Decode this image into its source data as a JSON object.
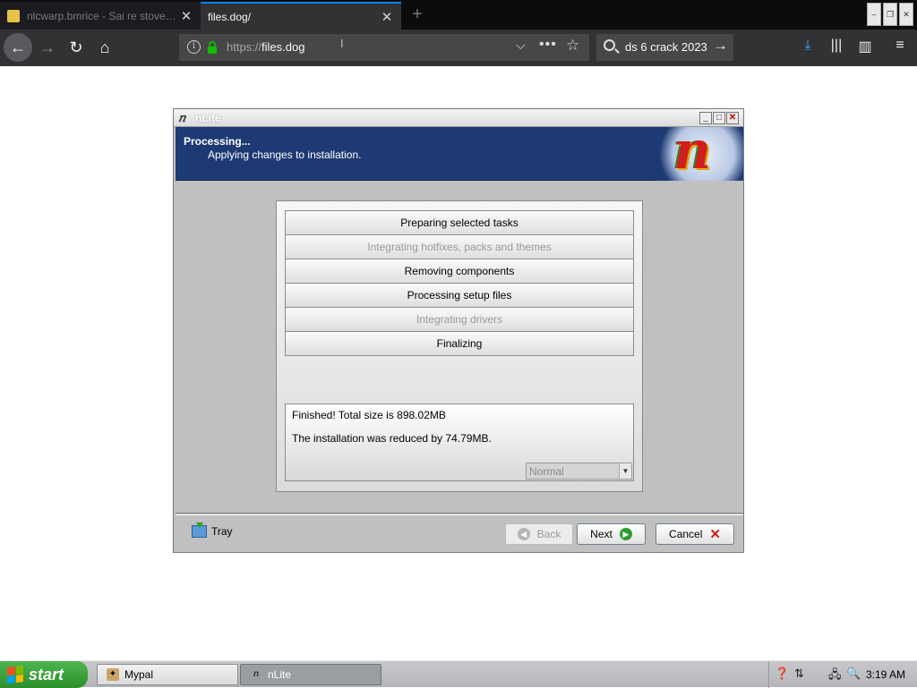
{
  "browser": {
    "tabs": [
      {
        "label": "nlcwarp.bmrice - Sai re stove rewind",
        "active": false
      },
      {
        "label": "files.dog/",
        "active": true
      }
    ],
    "url_scheme": "https://",
    "url_host": "files.dog",
    "search_text": "ds 6 crack 2023"
  },
  "window": {
    "title": "nLite",
    "header_title": "Processing...",
    "header_subtitle": "Applying changes to installation.",
    "logo_letter": "n",
    "tasks": [
      {
        "label": "Preparing selected tasks",
        "state": "done"
      },
      {
        "label": "Integrating hotfixes, packs and themes",
        "state": "skipped"
      },
      {
        "label": "Removing components",
        "state": "done"
      },
      {
        "label": "Processing setup files",
        "state": "done"
      },
      {
        "label": "Integrating drivers",
        "state": "skipped"
      },
      {
        "label": "Finalizing",
        "state": "done"
      }
    ],
    "log_line_1": "Finished! Total size is 898.02MB",
    "log_line_2": "The installation was reduced by 74.79MB.",
    "priority_value": "Normal",
    "tray_label": "Tray",
    "back_label": "Back",
    "next_label": "Next",
    "cancel_label": "Cancel"
  },
  "taskbar": {
    "start_label": "start",
    "items": [
      {
        "label": "Mypal",
        "active": false
      },
      {
        "label": "nLite",
        "active": true
      }
    ],
    "clock": "3:19 AM"
  },
  "colors": {
    "header_bg": "#1e3a74",
    "tab_accent": "#0a84ff",
    "start_green": "#3aa33a"
  }
}
